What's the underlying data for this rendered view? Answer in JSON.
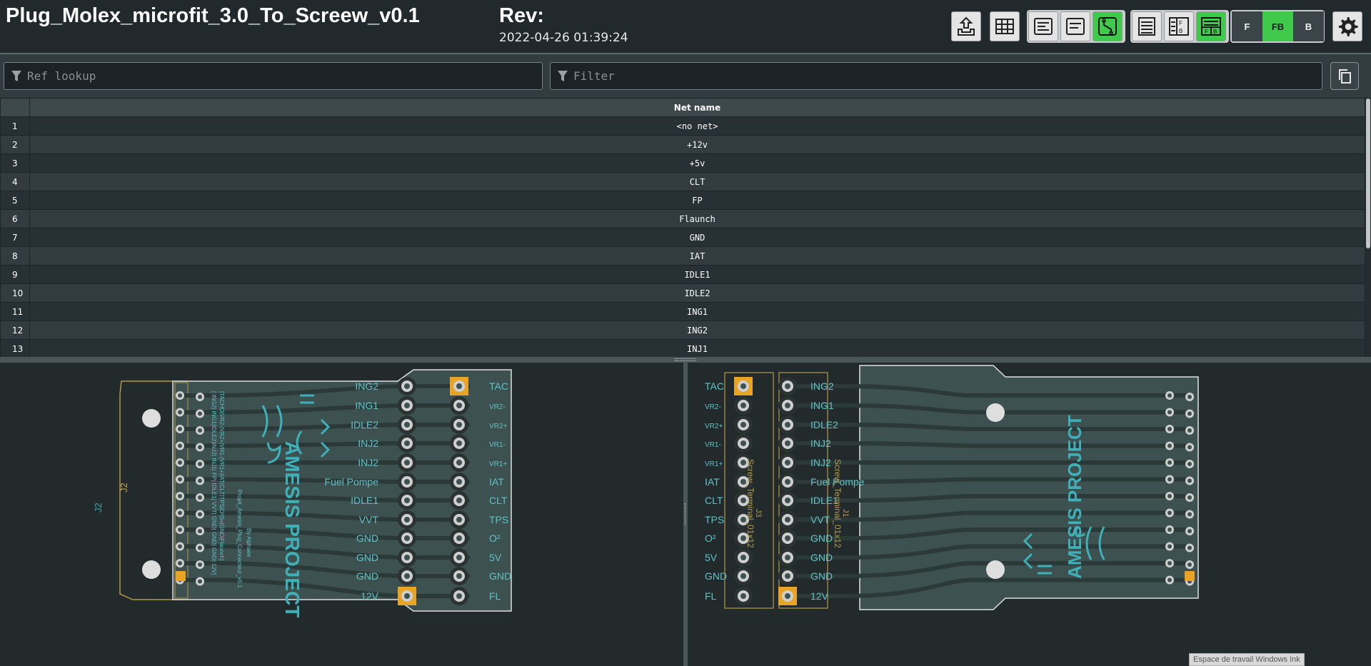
{
  "header": {
    "title": "Plug_Molex_microfit_3.0_To_Screew_v0.1",
    "rev_label": "Rev:",
    "rev_date": "2022-04-26 01:39:24"
  },
  "toolbar": {
    "buttons": [
      {
        "name": "upload-icon",
        "active": false
      },
      {
        "name": "grid-icon",
        "active": false
      },
      {
        "name": "silkscreen-toggle-icon",
        "active": false
      },
      {
        "name": "fab-toggle-icon",
        "active": false
      },
      {
        "name": "tracks-toggle-icon",
        "active": true
      },
      {
        "name": "bom-only-icon",
        "active": false
      },
      {
        "name": "bom-left-right-icon",
        "active": false
      },
      {
        "name": "bom-top-bottom-icon",
        "active": true
      }
    ],
    "layers": {
      "front": "F",
      "front_back": "FB",
      "back": "B",
      "active": "FB"
    },
    "settings_icon": "gear-icon"
  },
  "filters": {
    "ref_lookup_placeholder": "Ref lookup",
    "filter_placeholder": "Filter",
    "filter_icon": "funnel-icon",
    "copy_icon": "copy-icon"
  },
  "table": {
    "column_header": "Net name",
    "rows": [
      {
        "index": "1",
        "net": "<no net>"
      },
      {
        "index": "2",
        "net": "+12v"
      },
      {
        "index": "3",
        "net": "+5v"
      },
      {
        "index": "4",
        "net": "CLT"
      },
      {
        "index": "5",
        "net": "FP"
      },
      {
        "index": "6",
        "net": "Flaunch"
      },
      {
        "index": "7",
        "net": "GND"
      },
      {
        "index": "8",
        "net": "IAT"
      },
      {
        "index": "9",
        "net": "IDLE1"
      },
      {
        "index": "10",
        "net": "IDLE2"
      },
      {
        "index": "11",
        "net": "ING1"
      },
      {
        "index": "12",
        "net": "ING2"
      },
      {
        "index": "13",
        "net": "INJ1"
      }
    ]
  },
  "board_front": {
    "ref_outline": "J2",
    "ref_outline2": "J2",
    "left_labels": [
      "ING2",
      "ING1",
      "IDLE2",
      "INJ2",
      "INJ2",
      "Fuel Pompe",
      "IDLE1",
      "VVT",
      "GND",
      "GND",
      "GND",
      "12V"
    ],
    "right_labels": [
      "TAC",
      "VR2-",
      "VR2+",
      "VR1-",
      "VR1+",
      "IAT",
      "CLT",
      "TPS",
      "O²",
      "5V",
      "GND",
      "FL"
    ],
    "logo_text": "AMESIS PROJECT",
    "silk_text_1": "[TACHO|VR2-|VR2+|VR1-|VR1+|IAT|CLT|TPS|O²|5v|GND|Flaunch]",
    "silk_text_2": "[ ING2| ING1|IDLE2|INJ2| INJ1| FP| IDLE1| VVT| GND| GND| GND| 12V]",
    "silk_text_3": "Projet_Amesis_Plug_Connecteur_v0.1",
    "silk_text_4": "By Alphaee"
  },
  "board_back": {
    "ref_j3": "J3",
    "ref_j1": "J1",
    "screw_label_1": "Screw_Terminal_01x12",
    "screw_label_2": "Screw_Terminal_01x12",
    "left_labels": [
      "TAC",
      "VR2-",
      "VR2+",
      "VR1-",
      "VR1+",
      "IAT",
      "CLT",
      "TPS",
      "O²",
      "5V",
      "GND",
      "FL"
    ],
    "right_labels": [
      "ING2",
      "ING1",
      "IDLE2",
      "INJ2",
      "INJ2",
      "Fuel Pompe",
      "IDLE1",
      "VVT",
      "GND",
      "GND",
      "GND",
      "12V"
    ],
    "logo_text": "AMESIS PROJECT"
  },
  "tooltip": "Espace de travail Windows Ink"
}
